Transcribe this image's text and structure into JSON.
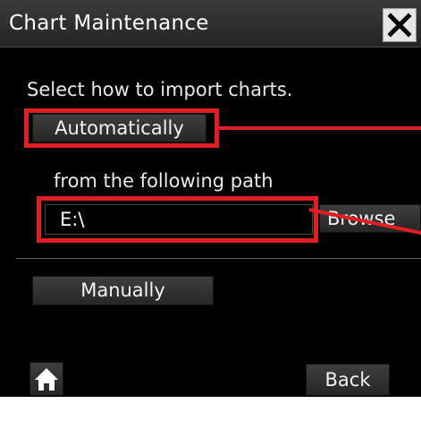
{
  "window": {
    "title": "Chart Maintenance"
  },
  "content": {
    "instruction": "Select how to import charts.",
    "automatic_label": "Automatically",
    "path_label": "from the following path",
    "path_value": "E:\\",
    "browse_label": "Browse",
    "manual_label": "Manually"
  },
  "footer": {
    "back_label": "Back"
  },
  "icons": {
    "close": "close-icon",
    "home": "home-icon"
  },
  "colors": {
    "highlight": "#e01e24",
    "dialog_bg": "#000000",
    "button_bg": "#333333",
    "text": "#ffffff"
  }
}
